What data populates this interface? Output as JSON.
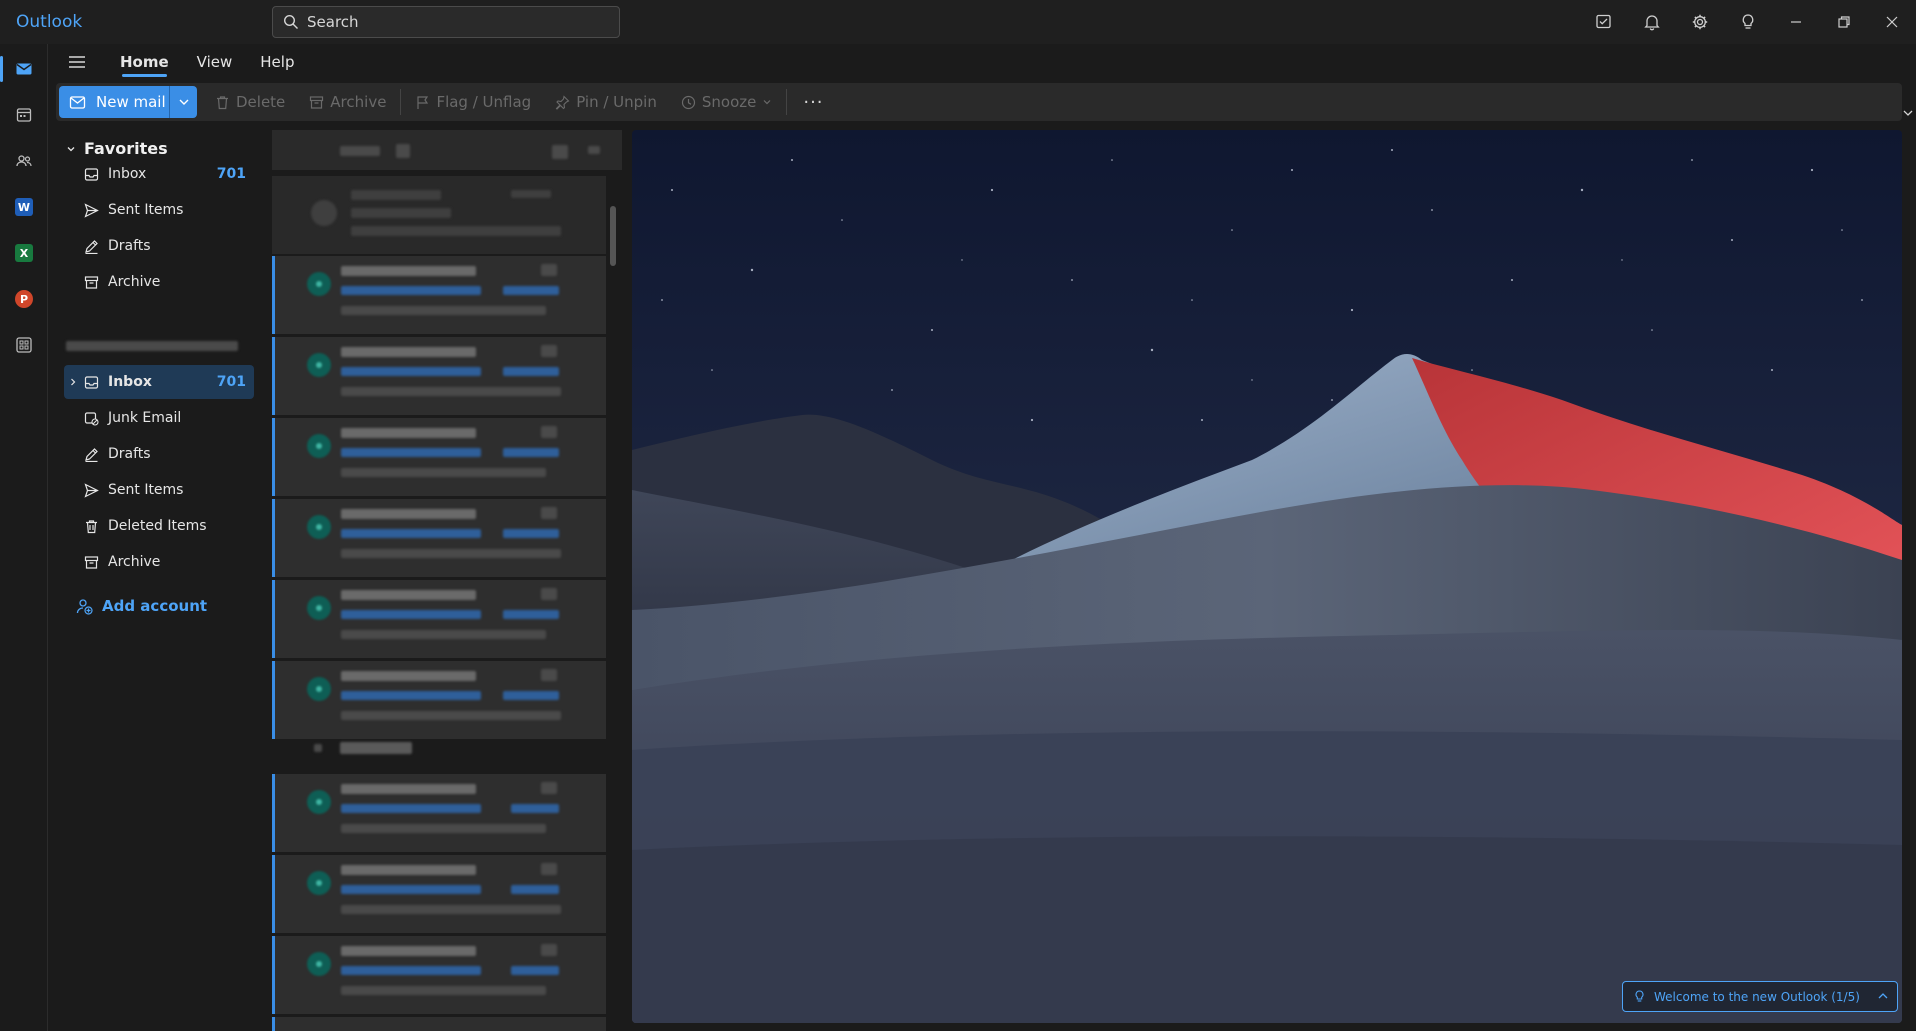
{
  "app": {
    "title": "Outlook"
  },
  "search": {
    "placeholder": "Search"
  },
  "tabs": [
    {
      "label": "Home",
      "active": true
    },
    {
      "label": "View",
      "active": false
    },
    {
      "label": "Help",
      "active": false
    }
  ],
  "toolbar": {
    "new_mail": "New mail",
    "delete": "Delete",
    "archive": "Archive",
    "flag": "Flag / Unflag",
    "pin": "Pin / Unpin",
    "snooze": "Snooze",
    "more": "···"
  },
  "favorites": {
    "header": "Favorites",
    "items": [
      {
        "label": "Inbox",
        "icon": "inbox-icon",
        "count": "701"
      },
      {
        "label": "Sent Items",
        "icon": "send-icon",
        "count": ""
      },
      {
        "label": "Drafts",
        "icon": "drafts-icon",
        "count": ""
      },
      {
        "label": "Archive",
        "icon": "archive-icon",
        "count": ""
      }
    ]
  },
  "account_folders": [
    {
      "label": "Inbox",
      "icon": "inbox-icon",
      "count": "701",
      "selected": true
    },
    {
      "label": "Junk Email",
      "icon": "junk-icon",
      "count": ""
    },
    {
      "label": "Drafts",
      "icon": "drafts-icon",
      "count": ""
    },
    {
      "label": "Sent Items",
      "icon": "send-icon",
      "count": ""
    },
    {
      "label": "Deleted Items",
      "icon": "trash-icon",
      "count": ""
    },
    {
      "label": "Archive",
      "icon": "archive-icon",
      "count": ""
    }
  ],
  "add_account": "Add account",
  "welcome": {
    "text": "Welcome to the new Outlook  (1/5)"
  },
  "colors": {
    "accent": "#4ea4f7",
    "primary_button": "#3a8ee6",
    "background": "#1b1b1b"
  }
}
